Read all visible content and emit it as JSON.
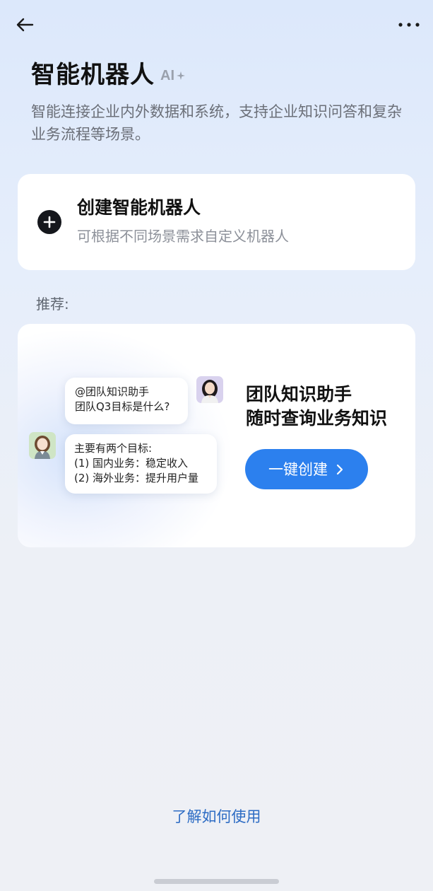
{
  "header": {
    "title": "智能机器人",
    "ai_badge": "AI",
    "description": "智能连接企业内外数据和系统，支持企业知识问答和复杂业务流程等场景。"
  },
  "create_card": {
    "title": "创建智能机器人",
    "subtitle": "可根据不同场景需求自定义机器人"
  },
  "recommend": {
    "label": "推荐:",
    "card": {
      "question_lines": [
        "@团队知识助手",
        "团队Q3目标是什么?"
      ],
      "answer_lines": [
        "主要有两个目标:",
        "(1) 国内业务：稳定收入",
        "(2) 海外业务：提升用户量"
      ],
      "title_line1": "团队知识助手",
      "title_line2": "随时查询业务知识",
      "button_label": "一键创建"
    }
  },
  "footer": {
    "learn_link": "了解如何使用"
  },
  "colors": {
    "accent": "#2c80ee",
    "link": "#2d6cc4",
    "background_top": "#dce8fb",
    "background_bottom": "#eef0f5"
  },
  "icons": {
    "back": "arrow-left-icon",
    "more": "more-dots-icon",
    "plus": "plus-circle-icon",
    "sparkle": "sparkle-icon",
    "chevron": "chevron-right-icon"
  }
}
